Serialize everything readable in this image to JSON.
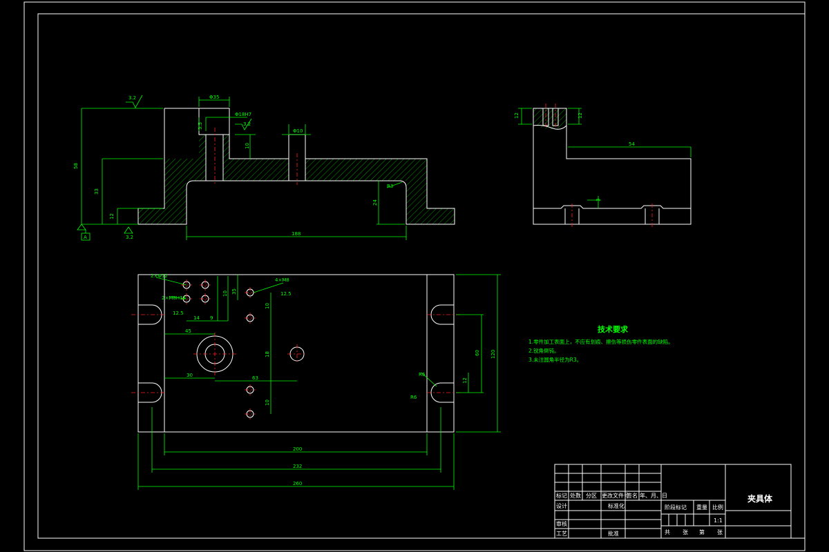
{
  "title_block": {
    "part_name": "夹具体",
    "scale_label": "比例",
    "scale_value": "1:1",
    "weight_label": "重量",
    "stage_mark_label": "阶段标记",
    "header_row": [
      "标记",
      "处数",
      "分区",
      "更改文件号",
      "签名",
      "年、月、日"
    ],
    "designer_label": "设计",
    "standardization_label": "标准化",
    "checker_label": "审核",
    "process_label": "工艺",
    "approval_label": "批准",
    "sheet_row": [
      "共",
      "张",
      "第",
      "张"
    ]
  },
  "technical_requirements": {
    "title": "技术要求",
    "items": [
      "1.零件加工表面上，不应有划痕、擦伤等损伤零件表面的缺陷。",
      "2.锐角倒钝。",
      "3.未注圆角半径为R3。"
    ]
  },
  "front_view_dims": {
    "top_width": "Φ35",
    "hole_label": "Φ18H7",
    "roughness_top": "3.2",
    "roughness_mid": "3.2",
    "roughness_bottom": "3.2",
    "small_right_dia": "Φ10",
    "height_total": "58",
    "height_mid": "33",
    "height_low": "12",
    "depth_inner": "24",
    "depth_small": "10",
    "radius": "R3",
    "depth_left": "3.5",
    "length_bottom": "188",
    "datum": "A"
  },
  "side_view_dims": {
    "top_left": "12",
    "top_right": "12",
    "width": "54",
    "small": "3"
  },
  "plan_view_dims": {
    "roughness_label": "12.5",
    "hole_note_1": "2×Φ12",
    "hole_note_2": "2×M8H13",
    "hole_note_3": "4×M8",
    "roughness_2": "12.5",
    "dim_14": "14",
    "dim_9": "9",
    "dim_45": "45",
    "dim_30": "30",
    "dim_63": "63",
    "dim_18": "18",
    "dim_35": "35",
    "dim_10a": "10",
    "dim_10b": "10",
    "dim_10c": "10",
    "dim_60": "60",
    "dim_120": "120",
    "dim_12": "12",
    "dim_r6": "R6",
    "dim_r6b": "R6",
    "dim_200": "200",
    "dim_232": "232",
    "dim_260": "260"
  }
}
